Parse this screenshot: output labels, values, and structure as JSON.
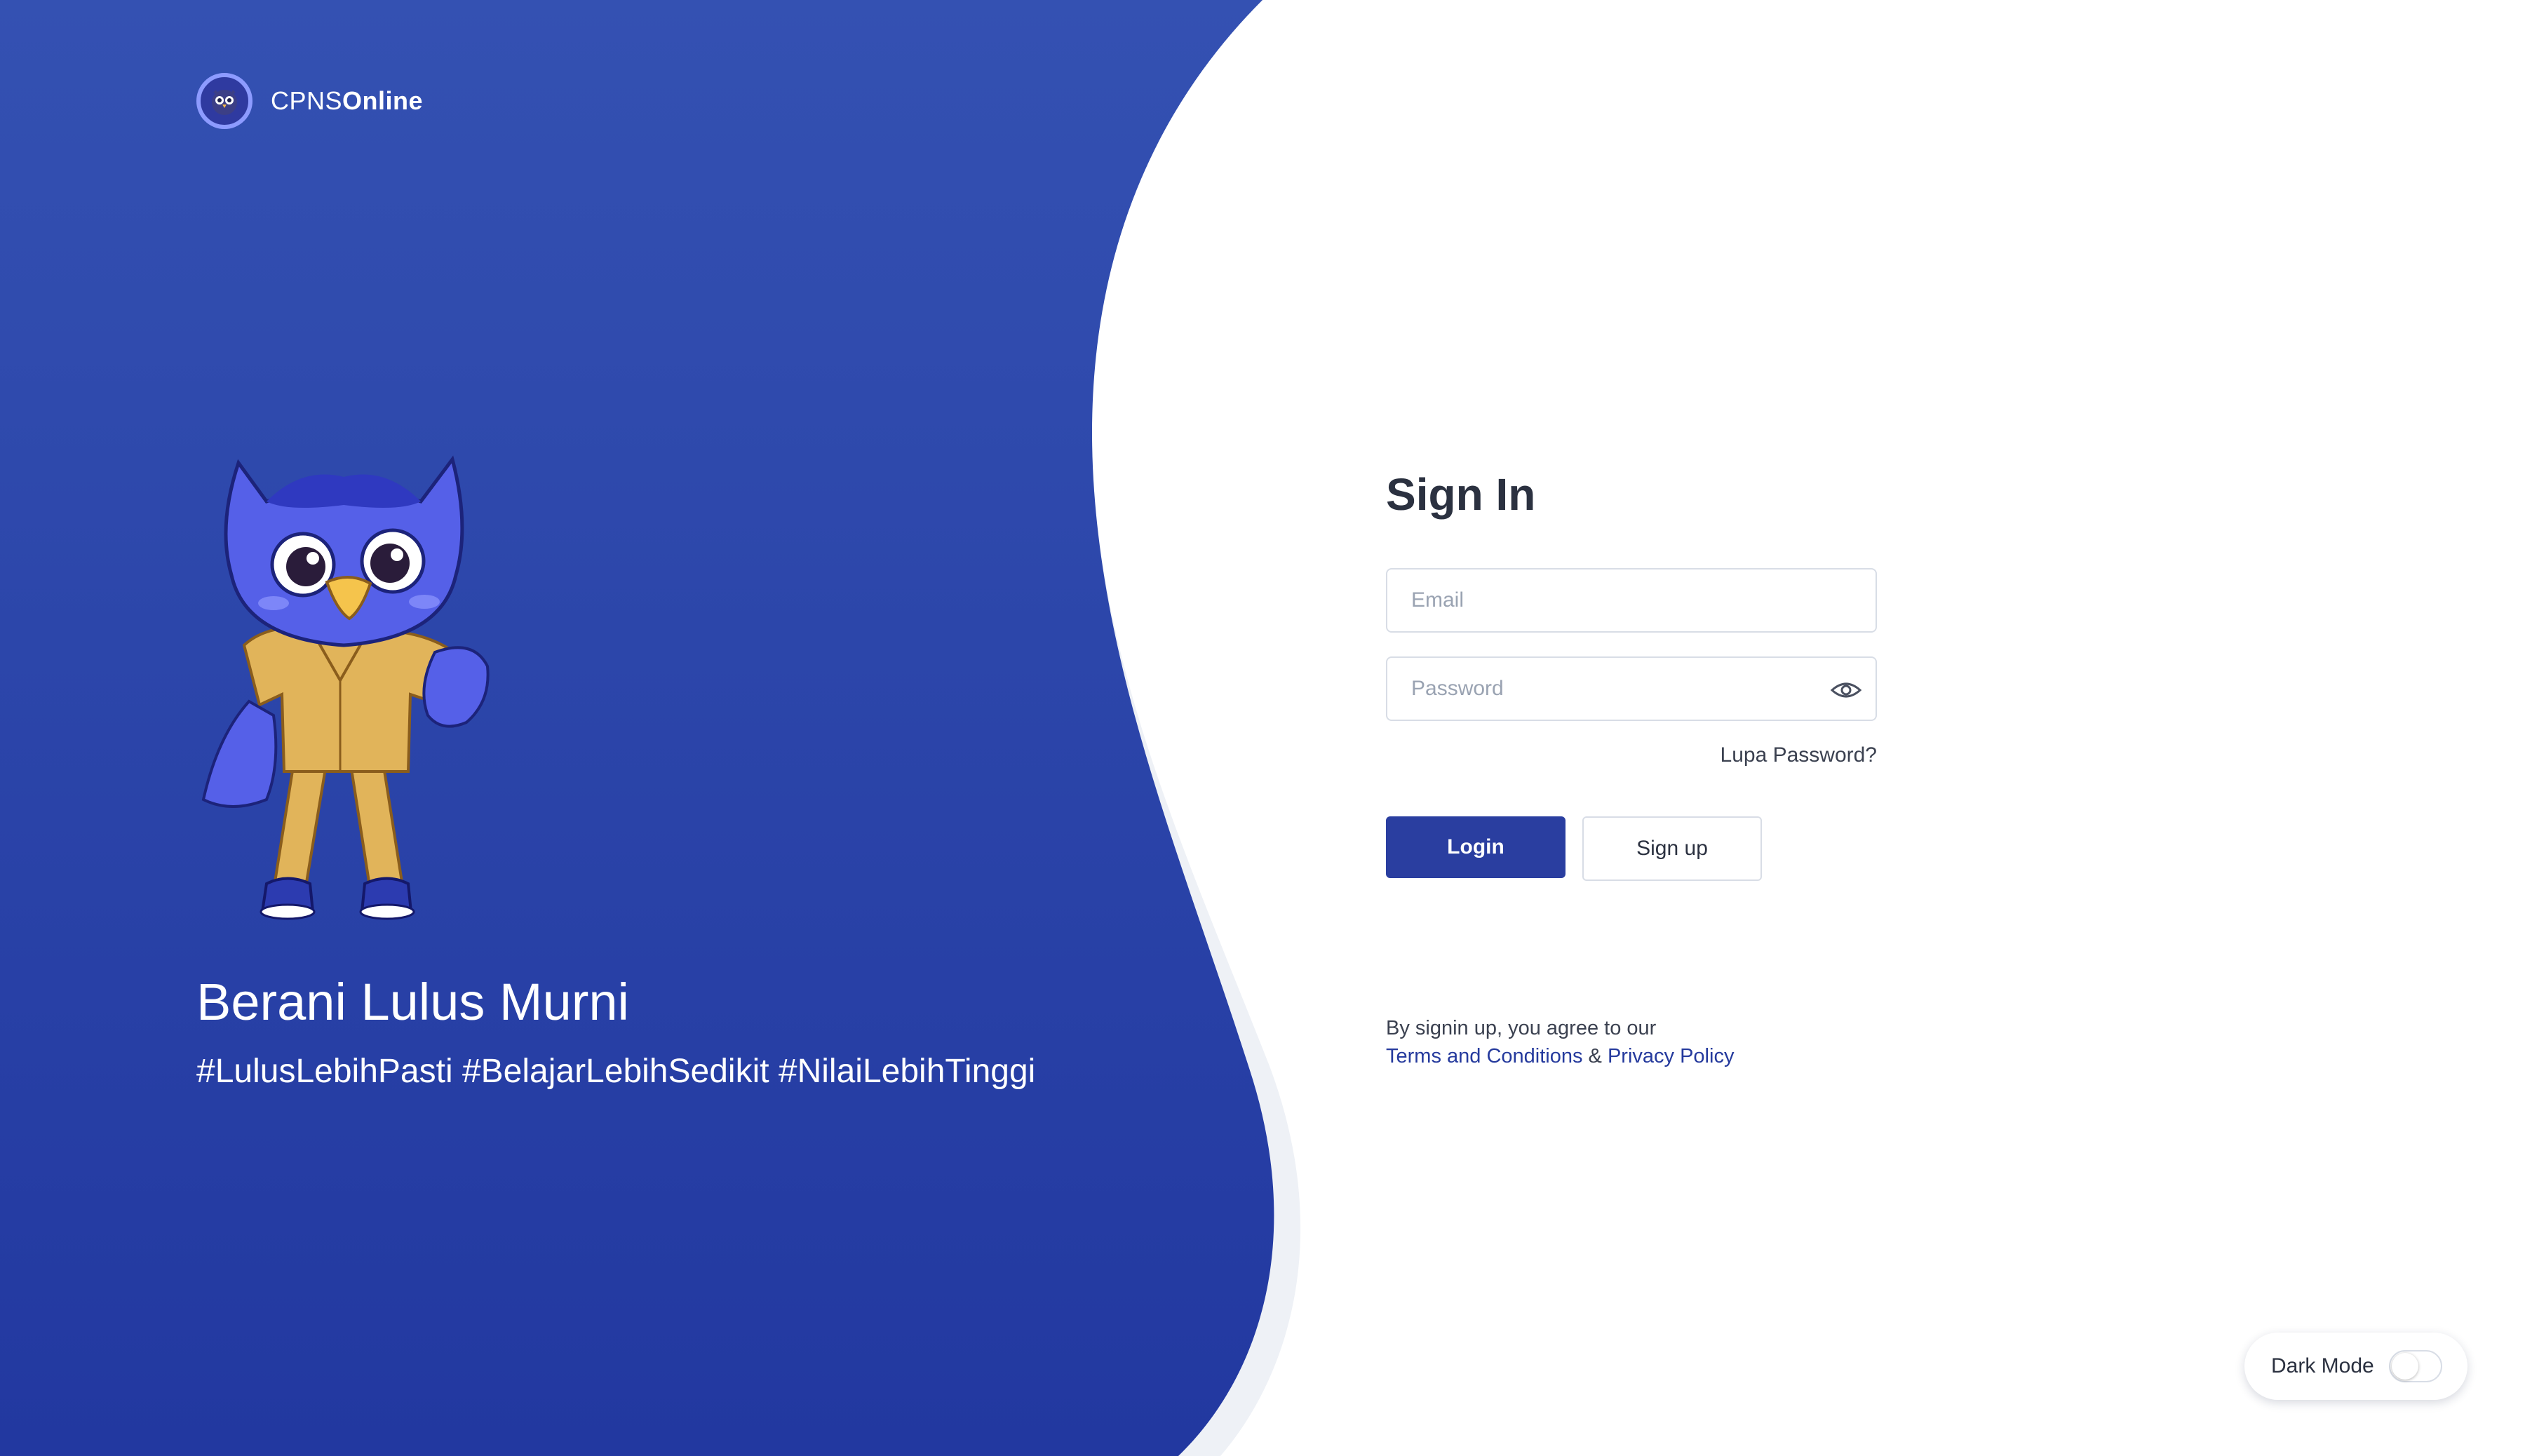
{
  "brand": {
    "name_prefix": "CPNS",
    "name_suffix": "Online",
    "logo_icon": "owl-logo-icon"
  },
  "hero": {
    "mascot": "owl-mascot-illustration",
    "title": "Berani Lulus Murni",
    "tags": "#LulusLebihPasti #BelajarLebihSedikit #NilaiLebihTinggi"
  },
  "signin": {
    "title": "Sign In",
    "email_placeholder": "Email",
    "email_value": "",
    "password_placeholder": "Password",
    "password_value": "",
    "password_toggle_icon": "eye-icon",
    "forgot_label": "Lupa Password?",
    "login_label": "Login",
    "signup_label": "Sign up",
    "legal_text": "By signin up, you agree to our",
    "terms_label": "Terms and Conditions",
    "and_text": "&",
    "privacy_label": "Privacy Policy"
  },
  "dark_mode": {
    "label": "Dark Mode",
    "enabled": false
  },
  "colors": {
    "panel_top": "#3451b2",
    "panel_bottom": "#2238a0",
    "primary_button": "#2a3ea0",
    "link": "#253a9d",
    "wave_shadow": "#eef1f6"
  }
}
